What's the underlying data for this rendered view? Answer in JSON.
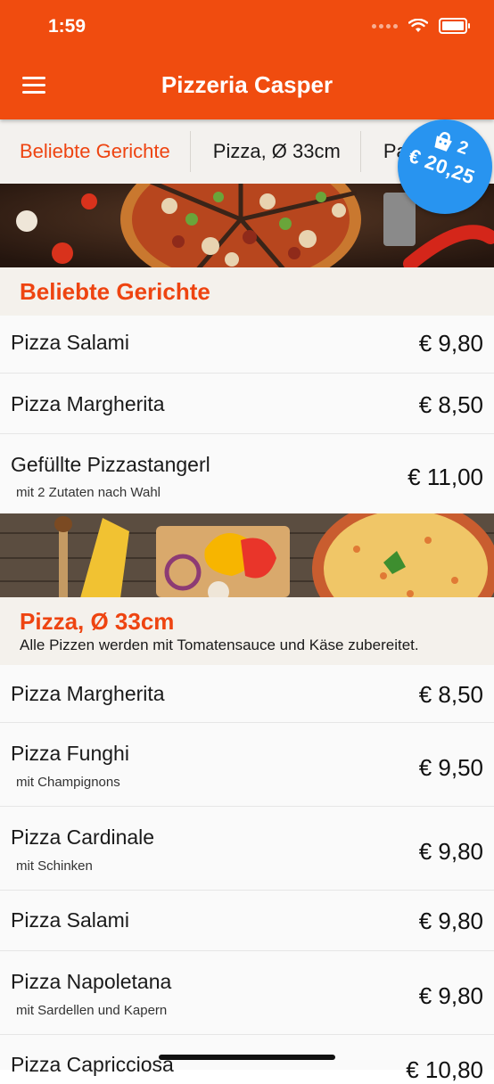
{
  "status": {
    "time": "1:59"
  },
  "header": {
    "title": "Pizzeria Casper",
    "menu_icon": "hamburger-icon"
  },
  "tabs": [
    {
      "label": "Beliebte Gerichte",
      "active": true
    },
    {
      "label": "Pizza, Ø 33cm",
      "active": false
    },
    {
      "label": "Pa",
      "active": false
    }
  ],
  "cart": {
    "count": "2",
    "total": "€ 20,25",
    "color": "#2894f0"
  },
  "colors": {
    "brand": "#f04c0f",
    "accent": "#ee4411"
  },
  "sections": [
    {
      "title": "Beliebte Gerichte",
      "items": [
        {
          "name": "Pizza Salami",
          "price": "€ 9,80"
        },
        {
          "name": "Pizza Margherita",
          "price": "€ 8,50"
        },
        {
          "name": "Gefüllte Pizzastangerl",
          "desc": "mit 2 Zutaten nach Wahl",
          "price": "€ 11,00"
        }
      ]
    },
    {
      "title": "Pizza, Ø 33cm",
      "description": "Alle Pizzen werden mit Tomatensauce und Käse zubereitet.",
      "items": [
        {
          "name": "Pizza Margherita",
          "price": "€ 8,50"
        },
        {
          "name": "Pizza Funghi",
          "desc": "mit Champignons",
          "price": "€ 9,50"
        },
        {
          "name": "Pizza Cardinale",
          "desc": "mit Schinken",
          "price": "€ 9,80"
        },
        {
          "name": "Pizza Salami",
          "price": "€ 9,80"
        },
        {
          "name": "Pizza Napoletana",
          "desc": "mit Sardellen und Kapern",
          "price": "€ 9,80"
        },
        {
          "name": "Pizza Capricciosa",
          "price": "€ 10,80"
        }
      ]
    }
  ]
}
